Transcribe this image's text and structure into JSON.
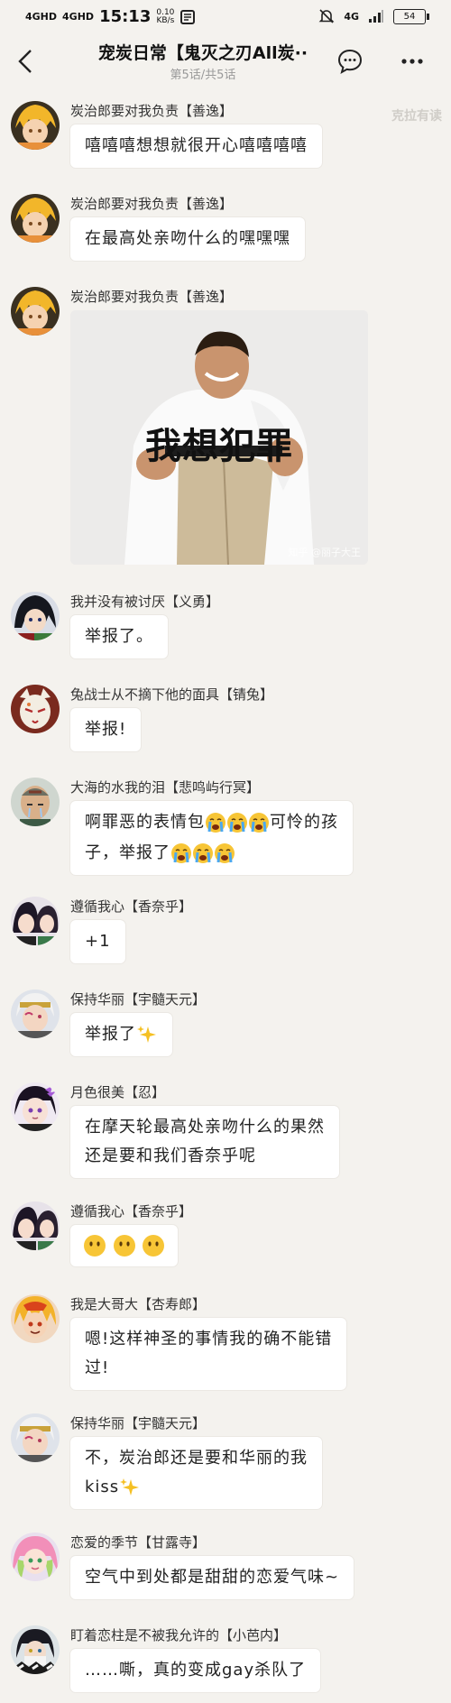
{
  "status": {
    "sig1": "4GHD",
    "sig2": "4GHD",
    "time": "15:13",
    "speed": "0.10",
    "speed_unit": "KB/s",
    "net": "4G",
    "battery": "54"
  },
  "header": {
    "title": "宠炭日常【鬼灭之刃All炭",
    "title_suffix": "··",
    "subtitle": "第5话/共5话"
  },
  "watermark": "克拉有读",
  "messages": [
    {
      "name": "炭治郎要对我负责【善逸】",
      "text": "嘻嘻嘻想想就很开心嘻嘻嘻嘻"
    },
    {
      "name": "炭治郎要对我负责【善逸】",
      "text": "在最高处亲吻什么的嘿嘿嘿"
    },
    {
      "name": "炭治郎要对我负责【善逸】",
      "image_caption": "我想犯罪",
      "image_credit": "知乎 @丽子大王"
    },
    {
      "name": "我并没有被讨厌【义勇】",
      "text": "举报了。"
    },
    {
      "name": "兔战士从不摘下他的面具【锖兔】",
      "text": "举报!"
    },
    {
      "name": "大海的水我的泪【悲鸣屿行冥】",
      "text_line1": "啊罪恶的表情包",
      "text_line1b": "可怜的孩",
      "text_line2": "子，举报了"
    },
    {
      "name": "遵循我心【香奈乎】",
      "text": "+1"
    },
    {
      "name": "保持华丽【宇髓天元】",
      "text": "举报了"
    },
    {
      "name": "月色很美【忍】",
      "text_line1": "在摩天轮最高处亲吻什么的果然",
      "text_line2": "还是要和我们香奈乎呢"
    },
    {
      "name": "遵循我心【香奈乎】"
    },
    {
      "name": "我是大哥大【杏寿郎】",
      "text_line1": "嗯!这样神圣的事情我的确不能错",
      "text_line2": "过!"
    },
    {
      "name": "保持华丽【宇髓天元】",
      "text_line1": "不，炭治郎还是要和华丽的我",
      "text_line2": "kiss"
    },
    {
      "name": "恋爱的季节【甘露寺】",
      "text": "空气中到处都是甜甜的恋爱气味~"
    },
    {
      "name": "盯着恋柱是不被我允许的【小芭内】",
      "text": "……嘶，真的变成gay杀队了"
    }
  ],
  "colors": {
    "background": "#f4f2ee",
    "bubble": "#ffffff",
    "name_text": "#333333",
    "subtitle": "#999999"
  },
  "icons": [
    "back-arrow-icon",
    "comment-icon",
    "more-icon",
    "crying-emoji-icon",
    "sparkles-icon",
    "neutral-face-emoji-icon"
  ]
}
